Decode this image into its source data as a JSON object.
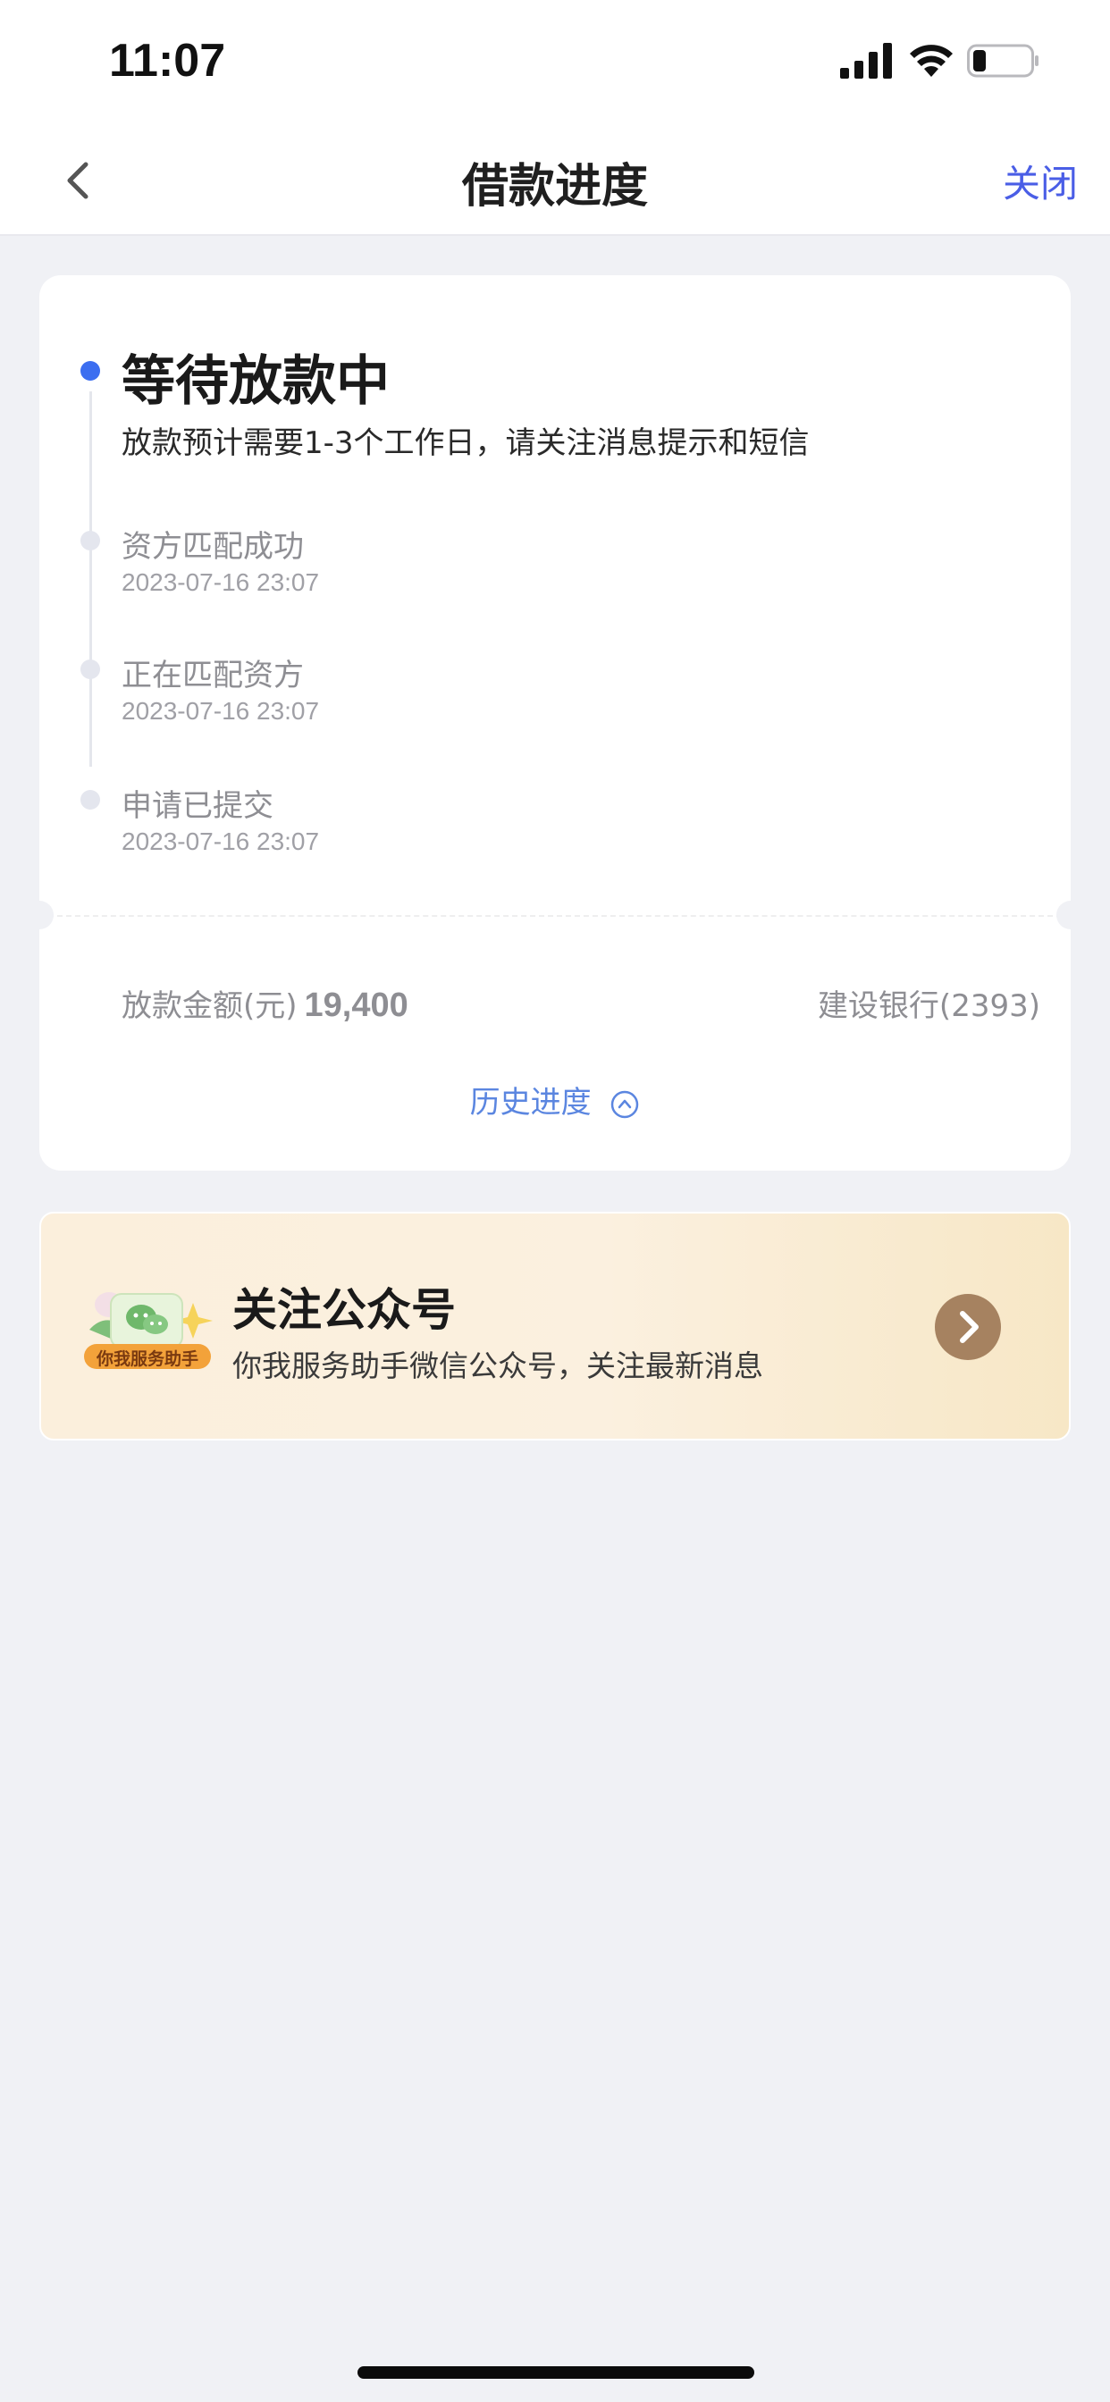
{
  "status_bar": {
    "time": "11:07"
  },
  "nav": {
    "title": "借款进度",
    "close_label": "关闭"
  },
  "progress": {
    "current_status": "等待放款中",
    "current_desc": "放款预计需要1-3个工作日，请关注消息提示和短信",
    "steps": [
      {
        "title": "资方匹配成功",
        "time": "2023-07-16 23:07"
      },
      {
        "title": "正在匹配资方",
        "time": "2023-07-16 23:07"
      },
      {
        "title": "申请已提交",
        "time": "2023-07-16 23:07"
      }
    ],
    "amount_label": "放款金额(元)",
    "amount_value": "19,400",
    "bank": "建设银行(2393)",
    "history_label": "历史进度"
  },
  "follow": {
    "badge_text": "你我服务助手",
    "title": "关注公众号",
    "subtitle": "你我服务助手微信公众号，关注最新消息"
  },
  "colors": {
    "accent_blue": "#3c6ef0",
    "link_blue": "#4a5ee6",
    "arrow_brown": "#a68260",
    "background": "#f0f1f5"
  },
  "icons": [
    "back-chevron-icon",
    "signal-icon",
    "wifi-icon",
    "battery-icon",
    "chevron-up-circle-icon",
    "wechat-icon",
    "arrow-right-icon"
  ]
}
